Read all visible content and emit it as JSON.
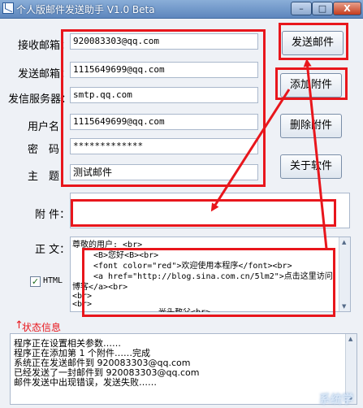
{
  "window": {
    "title": "个人版邮件发送助手 V1.0 Beta",
    "min_label": "–",
    "max_label": "□",
    "close_label": "X"
  },
  "form": {
    "to_label": "接收邮箱：",
    "to_value": "920083303@qq.com",
    "from_label": "发送邮箱：",
    "from_value": "1115649699@qq.com",
    "server_label": "发信服务器：",
    "server_value": "smtp.qq.com",
    "user_label": "用户名：",
    "user_value": "1115649699@qq.com",
    "password_label": "密　码：",
    "password_value": "*************",
    "subject_label": "主　题：",
    "subject_value": "测试邮件",
    "attachment_label": "附 件：",
    "attachment_value": "",
    "body_label": "正 文：",
    "html_label": "HTML",
    "html_checked": true
  },
  "buttons": {
    "send": "发送邮件",
    "add_attachment": "添加附件",
    "delete_attachment": "删除附件",
    "about": "关于软件"
  },
  "body_lines": [
    "尊敬的用户: <br>",
    "<B>您好<B><br>",
    "<font color=\"red\">欢迎使用本程序</font><br>",
    "<a href=\"http://blog.sina.com.cn/5lm2\">点击这里访问",
    "博客</a><br>",
    "<br>",
    "<br>",
    "光头敖父<br>"
  ],
  "status": {
    "label": "状态信息",
    "lines": [
      "程序正在设置相关参数……",
      "程序正在添加第 1 个附件……完成",
      "系统正在发送邮件到 920083303@qq.com",
      "已经发送了一封邮件到 920083303@qq.com",
      "邮件发送中出现错误，发送失败……"
    ]
  },
  "colors": {
    "highlight": "#e8161c",
    "title_bar": "#5d86bd",
    "window_bg": "#eef1f6"
  },
  "watermark": "系统学"
}
